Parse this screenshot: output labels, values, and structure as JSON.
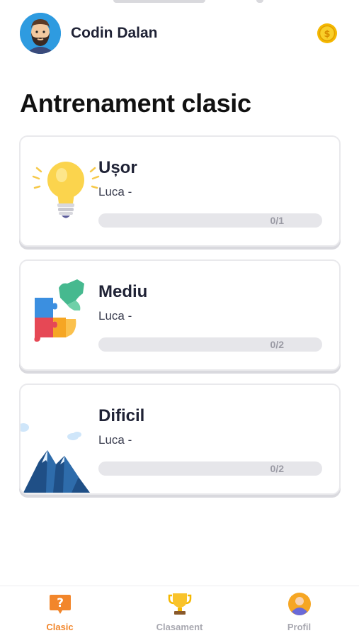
{
  "header": {
    "user_name": "Codin Dalan"
  },
  "page": {
    "title": "Antrenament clasic"
  },
  "cards": [
    {
      "name": "Ușor",
      "subtitle": "Luca -",
      "progress_text": "0/1",
      "progress": 0,
      "icon": "lightbulb-icon"
    },
    {
      "name": "Mediu",
      "subtitle": "Luca -",
      "progress_text": "0/2",
      "progress": 0,
      "icon": "puzzle-icon"
    },
    {
      "name": "Dificil",
      "subtitle": "Luca -",
      "progress_text": "0/2",
      "progress": 0,
      "icon": "mountain-icon"
    }
  ],
  "nav": {
    "items": [
      {
        "label": "Clasic",
        "icon": "question-icon",
        "active": true
      },
      {
        "label": "Clasament",
        "icon": "trophy-icon",
        "active": false
      },
      {
        "label": "Profil",
        "icon": "profile-icon",
        "active": false
      }
    ]
  },
  "colors": {
    "accent": "#f2862b",
    "progress_fill": "#f6a623",
    "inactive_nav": "#a8a8b0"
  }
}
